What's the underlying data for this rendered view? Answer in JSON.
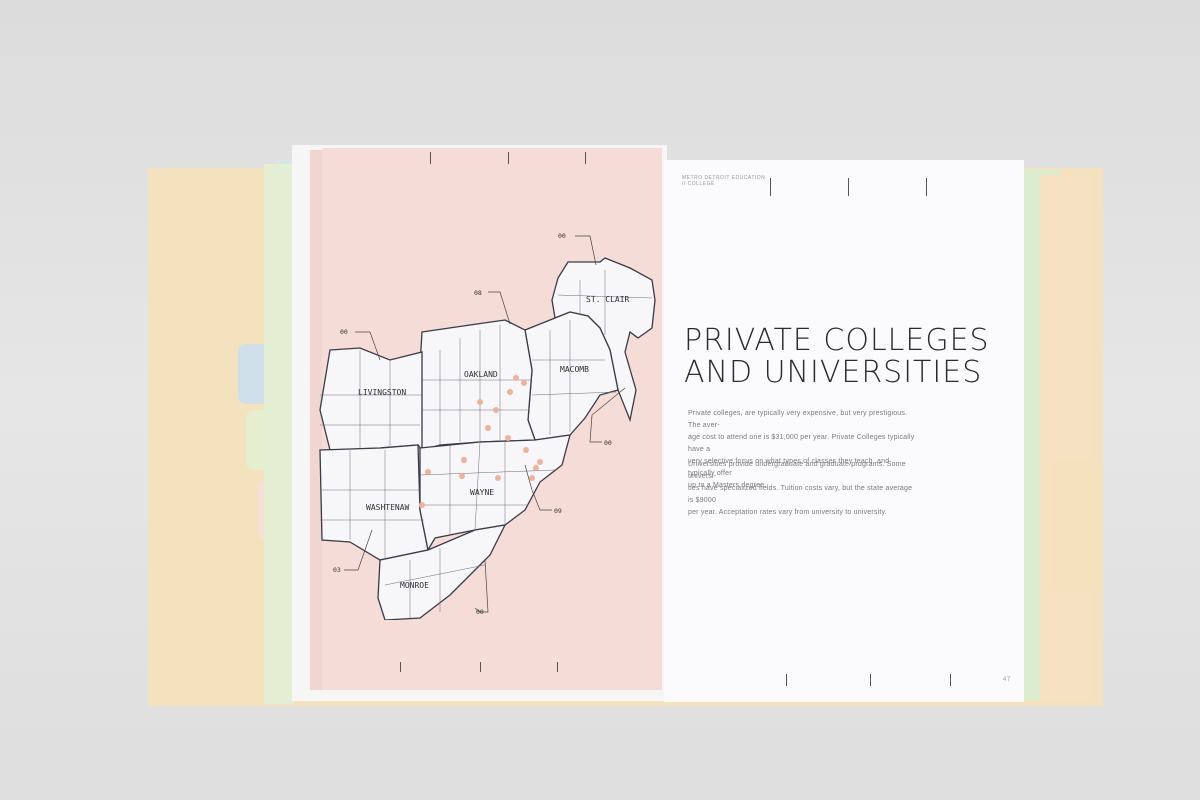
{
  "right_page": {
    "header_line1": "METRO DETROIT EDUCATION",
    "header_line2": "// COLLEGE",
    "heading_line1": "PRIVATE COLLEGES",
    "heading_line2": "AND UNIVERSITIES",
    "paragraph1": [
      "Private colleges, are typically very expensive, but very prestigious. The aver-",
      "age cost to attend one is $31,000 per year. Private Colleges typically have a",
      "very selective focus on what types of classes they teach, and typically offer",
      "up to a Masters degree."
    ],
    "paragraph2": [
      "Universities provide undergraduate and graduate programs. Some universi-",
      "ties have specialized fields. Tuition costs vary, but the state average is $9000",
      "per year. Acceptation rates vary from university to university."
    ],
    "page_number": "47"
  },
  "map": {
    "counties": [
      "ST. CLAIR",
      "OAKLAND",
      "MACOMB",
      "LIVINGSTON",
      "WASHTENAW",
      "WAYNE",
      "MONROE"
    ],
    "callouts": [
      "00",
      "08",
      "00",
      "00",
      "09",
      "03",
      "00"
    ],
    "dot_color": "#f0b29a",
    "background_color": "#f5dcd7"
  }
}
